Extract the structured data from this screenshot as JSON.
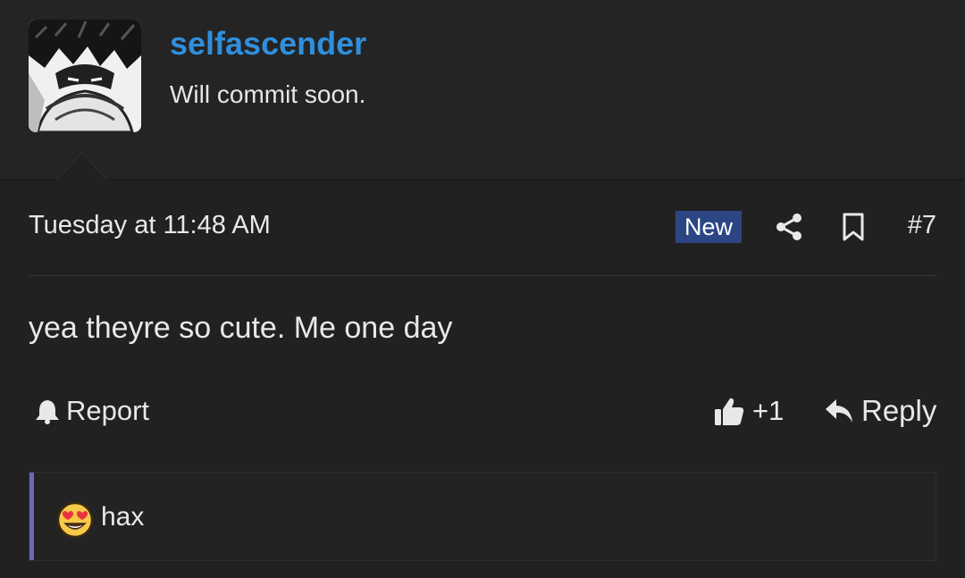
{
  "user": {
    "username": "selfascender",
    "title": "Will commit soon."
  },
  "post": {
    "date": "Tuesday at 11:48 AM",
    "new_badge": "New",
    "number": "#7",
    "body": "yea theyre so cute. Me one day"
  },
  "actions": {
    "report_label": "Report",
    "like_label": "+1",
    "reply_label": "Reply"
  },
  "reactions": {
    "emoji": "heart-eyes-emoji",
    "users": "hax"
  },
  "icons": {
    "share": "share-icon",
    "bookmark": "bookmark-icon",
    "bell": "bell-icon",
    "thumbs_up": "thumbs-up-icon",
    "reply": "reply-icon"
  },
  "colors": {
    "background": "#212121",
    "username": "#2f8fdc",
    "new_badge": "#2c4684",
    "reaction_accent": "#6a6ab8"
  }
}
